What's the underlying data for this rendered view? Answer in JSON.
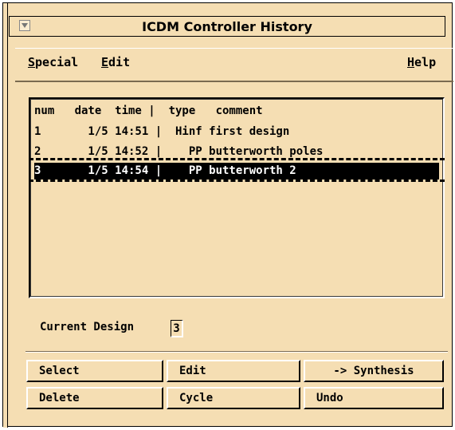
{
  "window": {
    "title": "ICDM Controller History"
  },
  "menubar": {
    "special": {
      "mnemonic": "S",
      "rest": "pecial"
    },
    "edit": {
      "mnemonic": "E",
      "rest": "dit"
    },
    "help": {
      "mnemonic": "H",
      "rest": "elp"
    }
  },
  "history": {
    "header": "num   date  time |  type   comment",
    "rows": [
      {
        "text": "1       1/5 14:51 |  Hinf first design",
        "selected": false
      },
      {
        "text": "2       1/5 14:52 |    PP butterworth poles",
        "selected": false
      },
      {
        "text": "3       1/5 14:54 |    PP butterworth 2",
        "selected": true
      }
    ]
  },
  "current_design": {
    "label": "Current Design",
    "value": "3"
  },
  "buttons": {
    "select": "Select",
    "edit": "Edit",
    "synthesis": "-> Synthesis",
    "delete": "Delete",
    "cycle": "Cycle",
    "undo": "Undo"
  }
}
